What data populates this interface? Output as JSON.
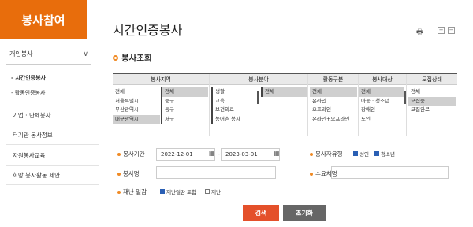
{
  "sidebar": {
    "logo": "봉사참여",
    "top": "개인봉사",
    "sub": [
      "- 시간인증봉사",
      "- 활동인증봉사"
    ],
    "menu": [
      "기업 · 단체봉사",
      "터기관 봉사정보",
      "자원봉사교육",
      "희망 봉사활동 제안"
    ]
  },
  "page": {
    "title": "시간인증봉사",
    "section": "봉사조회"
  },
  "filters": {
    "regionHead": "봉사지역",
    "regionA": [
      "전체",
      "서울특별시",
      "부산광역시",
      "대구광역시"
    ],
    "regionB": [
      "전체",
      "중구",
      "동구",
      "서구"
    ],
    "fieldHead": "봉사분야",
    "fieldA": [
      "생활",
      "교육",
      "보건의료",
      "농어촌 봉사"
    ],
    "fieldB": [
      "전체"
    ],
    "typeHead": "활동구분",
    "typeOpts": [
      "전체",
      "온라인",
      "오프라인",
      "온라인+오프라인"
    ],
    "targetHead": "봉사대상",
    "targetOpts": [
      "전체",
      "아동 · 청소년",
      "장애인",
      "노인"
    ],
    "statusHead": "모집상태",
    "statusOpts": [
      "전체",
      "모집중",
      "모집완료"
    ]
  },
  "form": {
    "periodLabel": "봉사기간",
    "dateFrom": "2022-12-01",
    "dateSep": "~",
    "dateTo": "2023-03-01",
    "volTypeLabel": "봉사자유형",
    "adult": "성인",
    "youth": "청소년",
    "nameLabel": "봉사명",
    "orgLabel": "수요처명",
    "disasterLabel": "재난 일감",
    "incDisaster": "재난일감 포함",
    "disasterOnly": "재난",
    "searchBtn": "검색",
    "resetBtn": "초기화"
  },
  "colors": {
    "accent": "#e86d0c",
    "search": "#e4502a",
    "reset": "#666666"
  },
  "icons": {
    "print": "printer-icon",
    "plus": "plus-icon",
    "minus": "minus-icon"
  }
}
